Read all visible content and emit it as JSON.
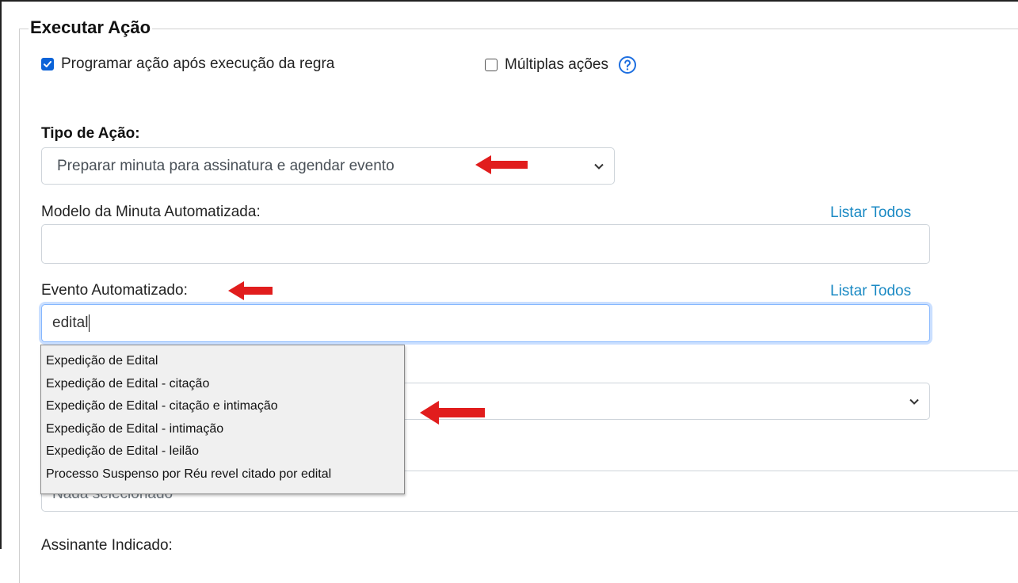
{
  "section": {
    "title": "Executar Ação"
  },
  "options": {
    "programar": {
      "label": "Programar ação após execução da regra",
      "checked": true
    },
    "multiplas": {
      "label": "Múltiplas ações",
      "checked": false
    }
  },
  "tipo_acao": {
    "label": "Tipo de Ação:",
    "selected": "Preparar minuta para assinatura e agendar evento"
  },
  "modelo_minuta": {
    "label": "Modelo da Minuta Automatizada:",
    "link": "Listar Todos",
    "value": ""
  },
  "evento": {
    "label": "Evento Automatizado:",
    "link": "Listar Todos",
    "value": "edital"
  },
  "autocomplete": {
    "options": [
      "Expedição de Edital",
      "Expedição de Edital - citação",
      "Expedição de Edital - citação e intimação",
      "Expedição de Edital - intimação",
      "Expedição de Edital - leilão",
      "Processo Suspenso por Réu revel citado por edital"
    ]
  },
  "multi_select": {
    "placeholder": "Nada selecionado"
  },
  "assinante": {
    "label": "Assinante Indicado:"
  },
  "colors": {
    "accent": "#0b63d8",
    "link": "#1b8ac4",
    "annotation_arrow": "#e11d1d",
    "focus_border": "#86b7fe"
  }
}
